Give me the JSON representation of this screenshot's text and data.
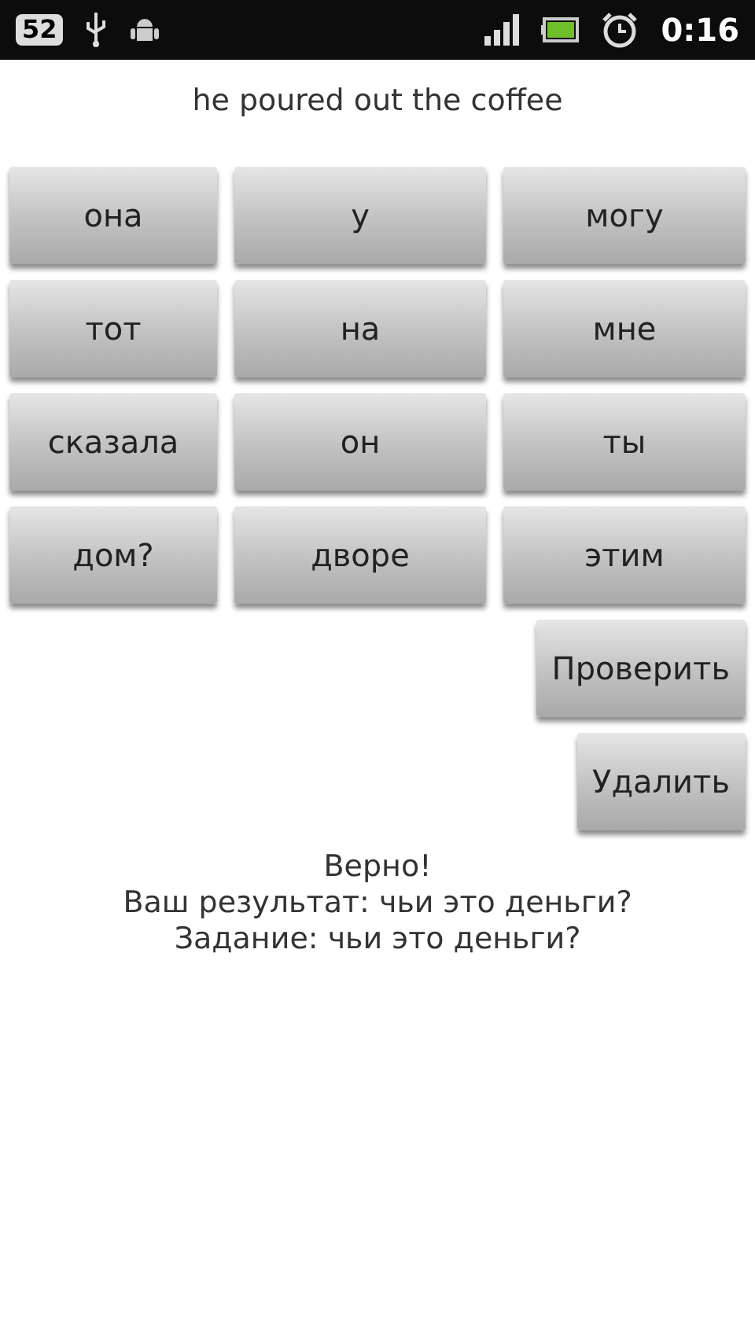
{
  "status_bar": {
    "notification_count": "52",
    "time": "0:16"
  },
  "prompt": "he poured out the coffee",
  "words": [
    "она",
    "у",
    "могу",
    "тот",
    "на",
    "мне",
    "сказала",
    "он",
    "ты",
    "дом?",
    "дворе",
    "этим"
  ],
  "actions": [
    "Проверить",
    "Удалить"
  ],
  "result": [
    "Верно!",
    "Ваш результат: чьи это деньги?",
    "Задание: чьи это деньги?"
  ]
}
